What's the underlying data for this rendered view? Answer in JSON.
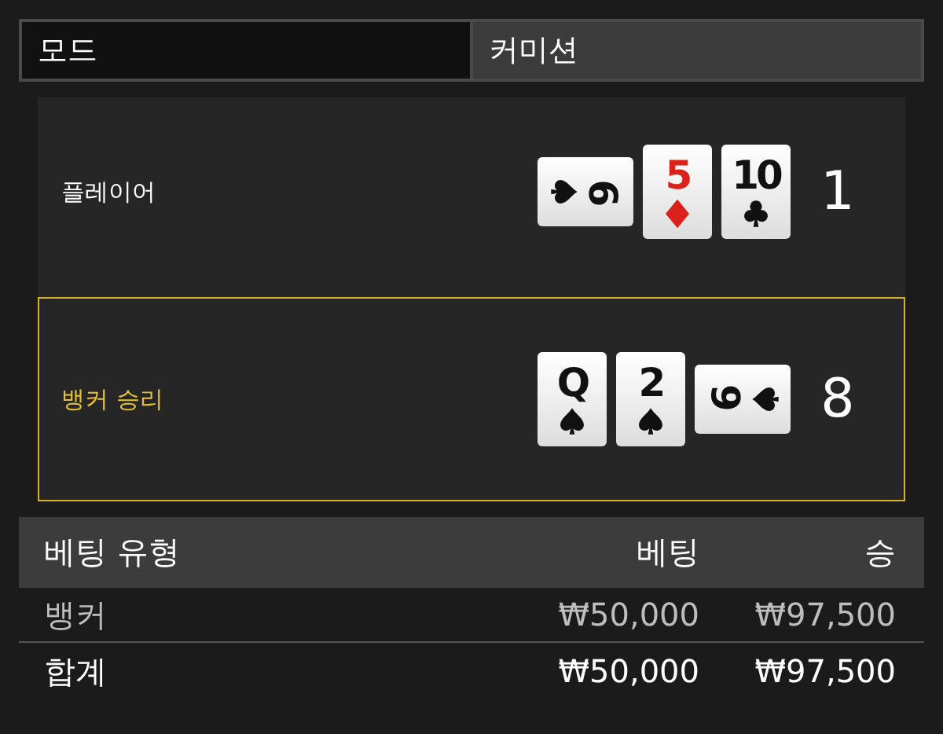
{
  "header": [
    {
      "label": "모드",
      "selected": true
    },
    {
      "label": "커미션",
      "selected": false
    }
  ],
  "hands": [
    {
      "label": "플레이어",
      "winner": false,
      "score": "1",
      "cards": [
        {
          "rank": "6",
          "kind": "spade",
          "sideways": true,
          "flipped": false
        },
        {
          "rank": "5",
          "kind": "diamond",
          "sideways": false,
          "flipped": false
        },
        {
          "rank": "10",
          "kind": "club",
          "sideways": false,
          "flipped": false
        }
      ]
    },
    {
      "label": "뱅커 승리",
      "winner": true,
      "score": "8",
      "cards": [
        {
          "rank": "Q",
          "kind": "spade",
          "sideways": false,
          "flipped": false
        },
        {
          "rank": "2",
          "kind": "spade",
          "sideways": false,
          "flipped": false
        },
        {
          "rank": "6",
          "kind": "spade",
          "sideways": true,
          "flipped": true
        }
      ]
    }
  ],
  "table": {
    "columns": [
      "베팅 유형",
      "베팅",
      "승"
    ],
    "rows": [
      [
        "뱅커",
        "₩50,000",
        "₩97,500"
      ]
    ],
    "total": [
      "합계",
      "₩50,000",
      "₩97,500"
    ]
  }
}
